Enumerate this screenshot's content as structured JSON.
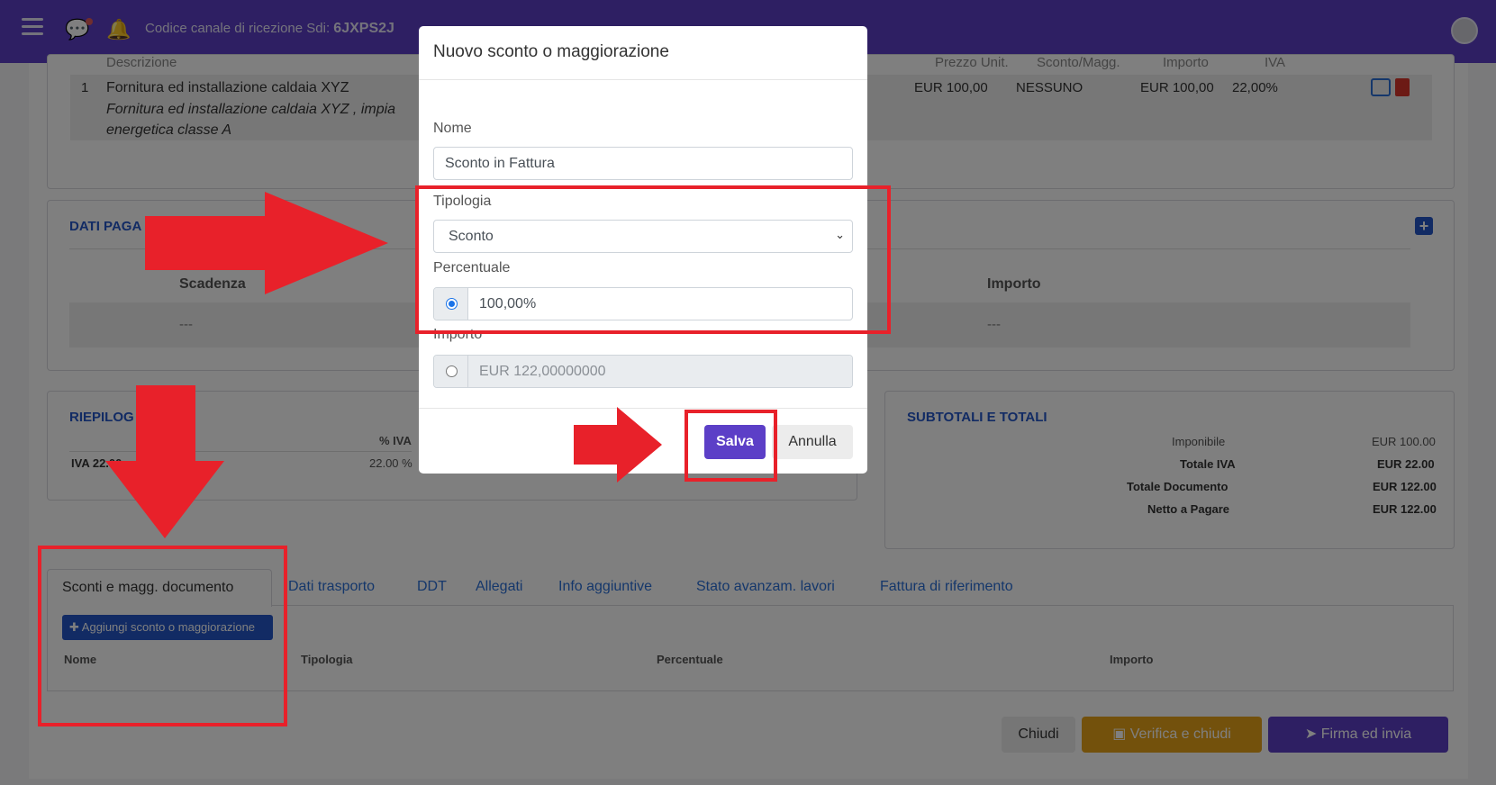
{
  "topbar": {
    "sdi_label": "Codice canale di ricezione Sdi:",
    "sdi_code": "6JXPS2J"
  },
  "righe": {
    "header_descrizione": "Descrizione",
    "header_prezzo": "Prezzo Unit.",
    "header_sconto": "Sconto/Magg.",
    "header_importo": "Importo",
    "header_iva": "IVA",
    "row": {
      "num": "1",
      "title": "Fornitura ed installazione caldaia XYZ",
      "desc_line1": "Fornitura ed installazione caldaia XYZ , impia",
      "desc_line2": "energetica classe A",
      "prezzo": "EUR 100,00",
      "sconto": "NESSUNO",
      "importo": "EUR 100,00",
      "iva": "22,00%"
    }
  },
  "pagamento": {
    "title": "DATI PAGA",
    "col_scadenza": "Scadenza",
    "col_importo": "Importo",
    "empty1": "---",
    "empty2": "---"
  },
  "riepilogo": {
    "title": "RIEPILOG",
    "col_iva": "% IVA",
    "row_label": "IVA 22.00",
    "row_iva": "22.00 %"
  },
  "totali": {
    "title": "SUBTOTALI E TOTALI",
    "rows": [
      {
        "label": "Imponibile",
        "value": "EUR 100.00"
      },
      {
        "label": "Totale IVA",
        "value": "EUR 22.00"
      },
      {
        "label": "Totale Documento",
        "value": "EUR 122.00"
      },
      {
        "label": "Netto a Pagare",
        "value": "EUR 122.00"
      }
    ]
  },
  "tabs": {
    "active": "Sconti e magg. documento",
    "items": [
      "Dati trasporto",
      "DDT",
      "Allegati",
      "Info aggiuntive",
      "Stato avanzam. lavori",
      "Fattura di riferimento"
    ]
  },
  "sconti": {
    "add_button": "Aggiungi sconto o maggiorazione",
    "col_nome": "Nome",
    "col_tipologia": "Tipologia",
    "col_percentuale": "Percentuale",
    "col_importo": "Importo"
  },
  "footer": {
    "chiudi": "Chiudi",
    "verifica": "Verifica e chiudi",
    "firma": "Firma ed invia"
  },
  "modal": {
    "title": "Nuovo sconto o maggiorazione",
    "nome_label": "Nome",
    "nome_value": "Sconto in Fattura",
    "tipologia_label": "Tipologia",
    "tipologia_value": "Sconto",
    "percentuale_label": "Percentuale",
    "percentuale_value": "100,00%",
    "importo_label": "Importo",
    "importo_value": "EUR 122,00000000",
    "salva": "Salva",
    "annulla": "Annulla"
  },
  "colors": {
    "brand": "#5c3fc7",
    "link": "#2456c8",
    "highlight": "#e8212a",
    "warning": "#e7a318"
  },
  "icons": [
    "menu-icon",
    "chat-icon",
    "bell-icon",
    "avatar-icon",
    "edit-icon",
    "trash-icon",
    "plus-square-icon",
    "plus-icon",
    "save-icon",
    "paper-plane-icon",
    "chevron-down-icon"
  ]
}
